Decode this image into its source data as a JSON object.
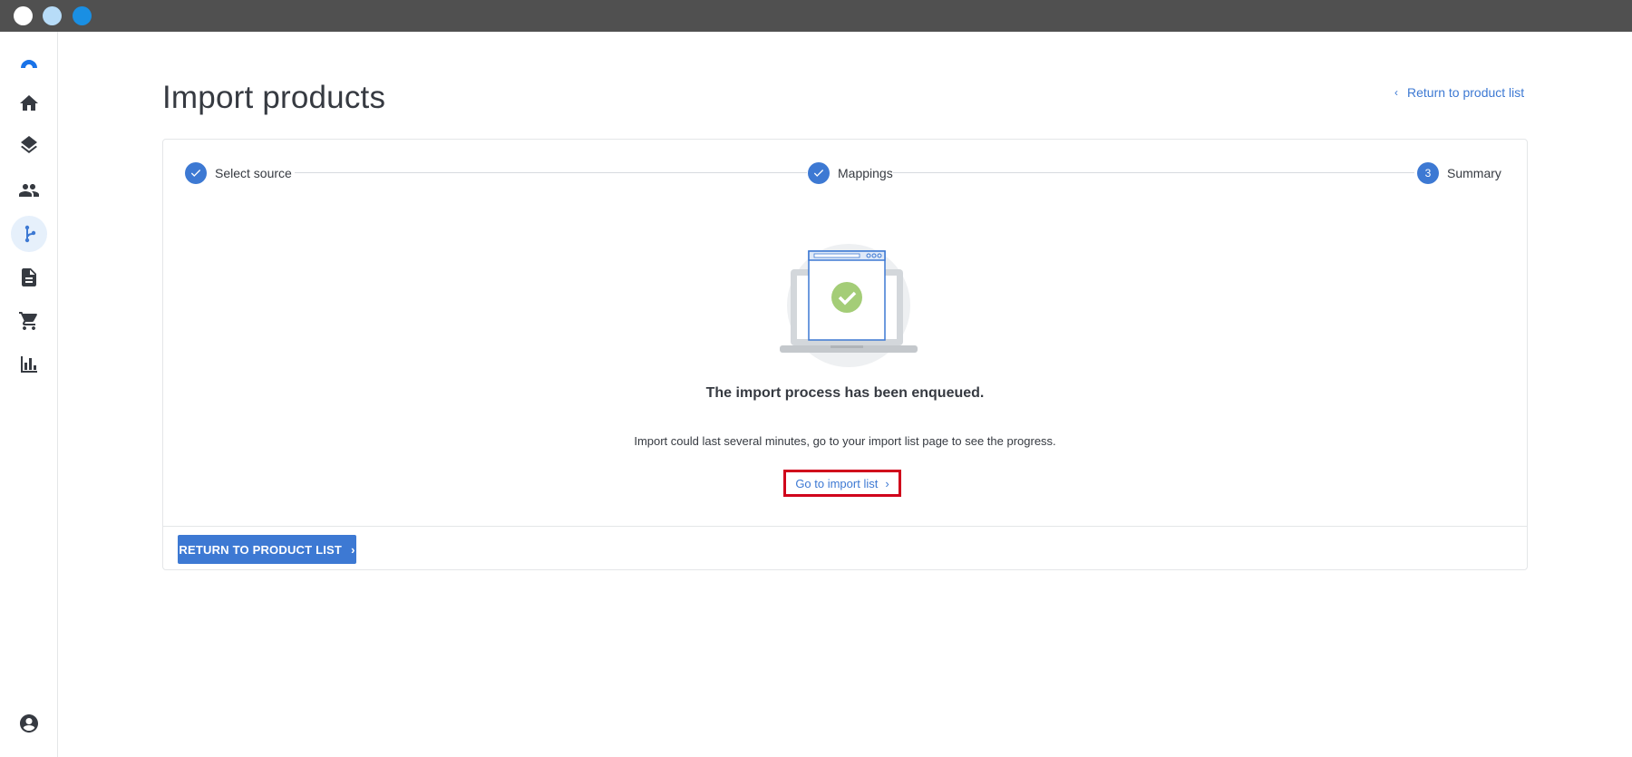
{
  "page": {
    "title": "Import products",
    "return_link": "Return to product list"
  },
  "stepper": {
    "steps": [
      {
        "label": "Select source",
        "status": "done"
      },
      {
        "label": "Mappings",
        "status": "done"
      },
      {
        "label": "Summary",
        "status": "current",
        "number": "3"
      }
    ]
  },
  "result": {
    "title": "The import process has been enqueued.",
    "body": "Import could last several minutes, go to your import list page to see the progress.",
    "link": "Go to import list"
  },
  "footer": {
    "primary_button": "RETURN TO PRODUCT LIST"
  },
  "sidebar": {
    "items": [
      {
        "icon": "home-icon"
      },
      {
        "icon": "layers-icon"
      },
      {
        "icon": "people-icon"
      },
      {
        "icon": "flow-icon",
        "active": true
      },
      {
        "icon": "document-icon"
      },
      {
        "icon": "cart-icon"
      },
      {
        "icon": "bar-chart-icon"
      },
      {
        "icon": "account-icon"
      }
    ]
  },
  "colors": {
    "accent": "#3d79d3",
    "highlight_border": "#d0021b",
    "success": "#a4cd77"
  }
}
